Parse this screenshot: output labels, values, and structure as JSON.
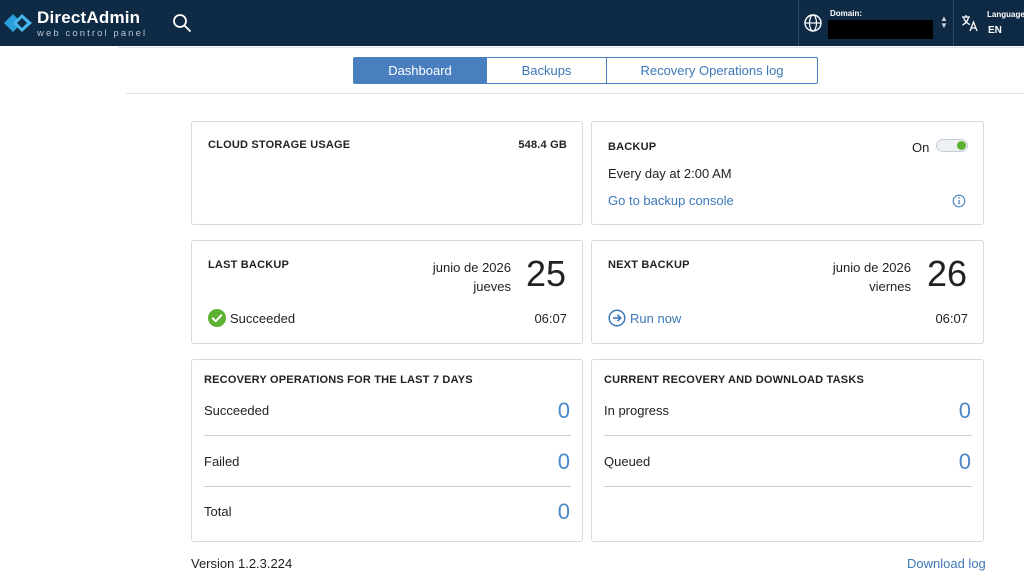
{
  "header": {
    "brand_name": "DirectAdmin",
    "brand_tagline": "web control panel",
    "domain_label": "Domain:",
    "language_label": "Language",
    "language_value": "EN"
  },
  "tabs": [
    {
      "label": "Dashboard",
      "active": true
    },
    {
      "label": "Backups",
      "active": false
    },
    {
      "label": "Recovery Operations log",
      "active": false
    }
  ],
  "cloud_storage": {
    "title": "CLOUD STORAGE USAGE",
    "value": "548.4 GB"
  },
  "backup": {
    "title": "BACKUP",
    "toggle_label": "On",
    "schedule": "Every day at 2:00 AM",
    "console_link": "Go to backup console"
  },
  "last_backup": {
    "title": "LAST BACKUP",
    "month_year": "junio de 2026",
    "weekday": "jueves",
    "day": "25",
    "status": "Succeeded",
    "time": "06:07"
  },
  "next_backup": {
    "title": "NEXT BACKUP",
    "month_year": "junio de 2026",
    "weekday": "viernes",
    "day": "26",
    "action": "Run now",
    "time": "06:07"
  },
  "recovery_ops": {
    "title": "RECOVERY OPERATIONS FOR THE LAST 7 DAYS",
    "rows": [
      {
        "label": "Succeeded",
        "value": "0"
      },
      {
        "label": "Failed",
        "value": "0"
      },
      {
        "label": "Total",
        "value": "0"
      }
    ]
  },
  "current_tasks": {
    "title": "CURRENT RECOVERY AND DOWNLOAD TASKS",
    "rows": [
      {
        "label": "In progress",
        "value": "0"
      },
      {
        "label": "Queued",
        "value": "0"
      }
    ]
  },
  "footer": {
    "version": "Version 1.2.3.224",
    "download_log": "Download log"
  },
  "colors": {
    "header_bg": "#0f2a44",
    "accent": "#4a7fbf",
    "link": "#3d78b8",
    "success": "#5db132",
    "count": "#4a88c6"
  },
  "icons": [
    "logo-icon",
    "search-icon",
    "globe-icon",
    "translate-icon",
    "info-icon",
    "check-circle-icon",
    "arrow-circle-right-icon"
  ]
}
